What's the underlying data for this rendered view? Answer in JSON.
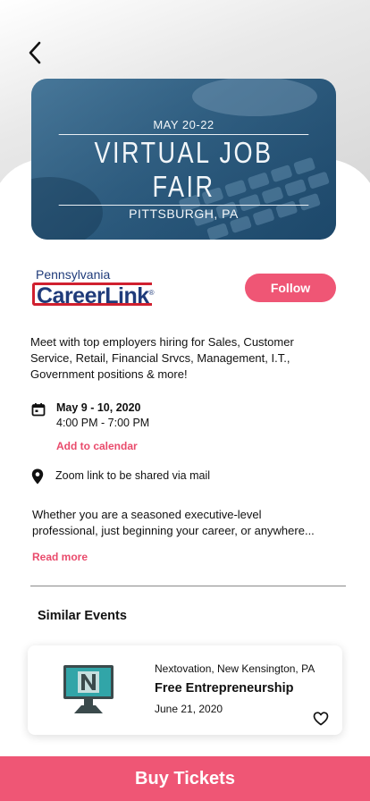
{
  "hero": {
    "date": "MAY 20-22",
    "title": "VIRTUAL JOB FAIR",
    "place": "PITTSBURGH, PA"
  },
  "organizer": {
    "logo_top": "Pennsylvania",
    "logo_main": "CareerLink",
    "logo_mark": "®",
    "follow_label": "Follow",
    "brand_color": "#1f3b7a",
    "accent_color": "#d0202f"
  },
  "event": {
    "description": "Meet with top employers hiring for Sales, Customer Service, Retail, Financial Srvcs, Management, I.T., Government positions & more!",
    "date": "May 9 - 10, 2020",
    "time": "4:00 PM - 7:00 PM",
    "add_to_calendar": "Add to calendar",
    "location": "Zoom link to be shared via mail",
    "about": "Whether you are a seasoned executive-level professional, just beginning your career, or anywhere...",
    "read_more": "Read more"
  },
  "similar": {
    "title": "Similar Events",
    "items": [
      {
        "organizer": "Nextovation, New Kensington, PA",
        "title": "Free Entrepreneurship",
        "date": "June 21, 2020"
      }
    ]
  },
  "buy_label": "Buy Tickets",
  "colors": {
    "primary": "#ef5675",
    "link": "#e94b6c"
  },
  "icons": {
    "back": "chevron-left-icon",
    "calendar": "calendar-icon",
    "location": "map-pin-icon",
    "favorite": "heart-icon"
  }
}
